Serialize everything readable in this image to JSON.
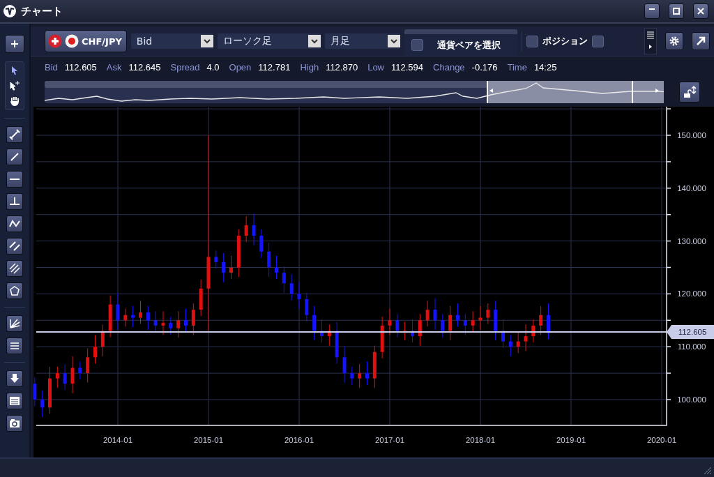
{
  "window": {
    "title": "チャート"
  },
  "toolbar": {
    "pair": "CHF/JPY",
    "dropdowns": [
      {
        "value": "Bid"
      },
      {
        "value": "ローソク足"
      },
      {
        "value": "月足"
      }
    ],
    "pair_selector": {
      "label": "通貨ペアを選択",
      "checked": false
    },
    "checkboxes": [
      {
        "label": "ポジション",
        "checked": false
      },
      {
        "checked": false
      }
    ]
  },
  "quote": [
    {
      "label": "Bid",
      "value": "112.605"
    },
    {
      "label": "Ask",
      "value": "112.645"
    },
    {
      "label": "Spread",
      "value": "4.0"
    },
    {
      "label": "Open",
      "value": "112.781"
    },
    {
      "label": "High",
      "value": "112.870"
    },
    {
      "label": "Low",
      "value": "112.594"
    },
    {
      "label": "Change",
      "value": "-0.176"
    },
    {
      "label": "Time",
      "value": "14:25"
    }
  ],
  "chart": {
    "y_axis_labels": [
      "150.000",
      "140.000",
      "130.000",
      "120.000",
      "110.000",
      "100.000"
    ],
    "x_axis_labels": [
      "2014-01",
      "2015-01",
      "2016-01",
      "2017-01",
      "2018-01",
      "2019-01",
      "2020-01"
    ],
    "price_label": "112.605"
  }
}
